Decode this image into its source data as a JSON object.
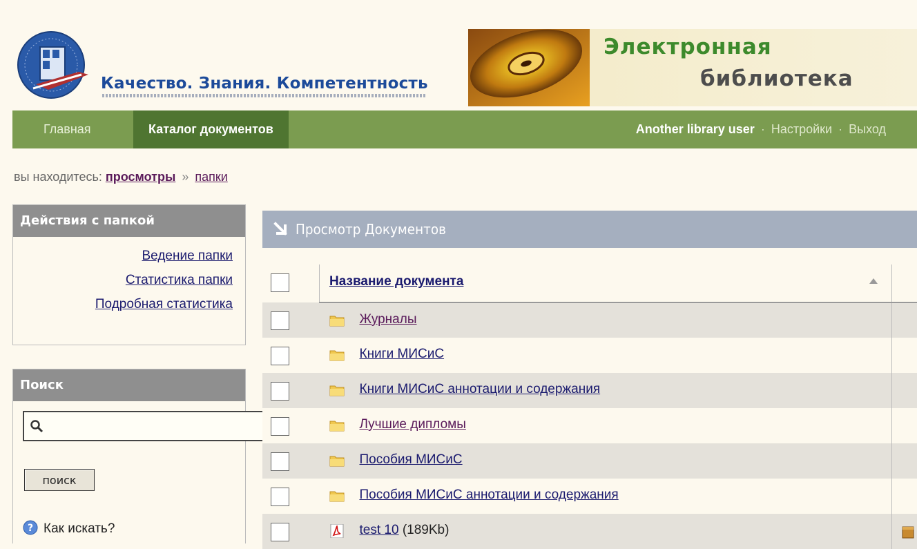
{
  "header": {
    "logo_title": "Качество. Знания. Компетентность",
    "banner_line1": "Электронная",
    "banner_line2": "библиотека"
  },
  "nav": {
    "home": "Главная",
    "catalog": "Каталог документов",
    "user_name": "Another library user",
    "separator": "·",
    "settings": "Настройки",
    "logout": "Выход"
  },
  "breadcrumb": {
    "prefix": "вы находитесь:",
    "views": "просмотры",
    "separator": "»",
    "folders": "папки"
  },
  "folder_actions": {
    "title": "Действия с папкой",
    "items": [
      {
        "label": "Ведение папки"
      },
      {
        "label": "Статистика папки"
      },
      {
        "label": "Подробная статистика"
      }
    ]
  },
  "search": {
    "title": "Поиск",
    "value": "",
    "placeholder": "",
    "button_label": "поиск",
    "help": "Как искать?"
  },
  "content": {
    "title": "Просмотр Документов",
    "column_header": "Название документа",
    "rows": [
      {
        "name": "Журналы",
        "type": "folder",
        "visited": true
      },
      {
        "name": "Книги МИСиС",
        "type": "folder",
        "visited": false
      },
      {
        "name": "Книги МИСиС аннотации и содержания",
        "type": "folder",
        "visited": false
      },
      {
        "name": "Лучшие дипломы",
        "type": "folder",
        "visited": true
      },
      {
        "name": "Пособия МИСиС",
        "type": "folder",
        "visited": false
      },
      {
        "name": "Пособия МИСиС аннотации и содержания",
        "type": "folder",
        "visited": false
      },
      {
        "name": "test 10",
        "type": "pdf",
        "size": "(189Kb)",
        "visited": false
      }
    ]
  },
  "colors": {
    "nav_bg": "#7b9c50",
    "nav_active": "#4f7531",
    "content_header_bg": "#a5afbf",
    "link": "#1a1a6e",
    "visited_link": "#5a1a5a"
  }
}
